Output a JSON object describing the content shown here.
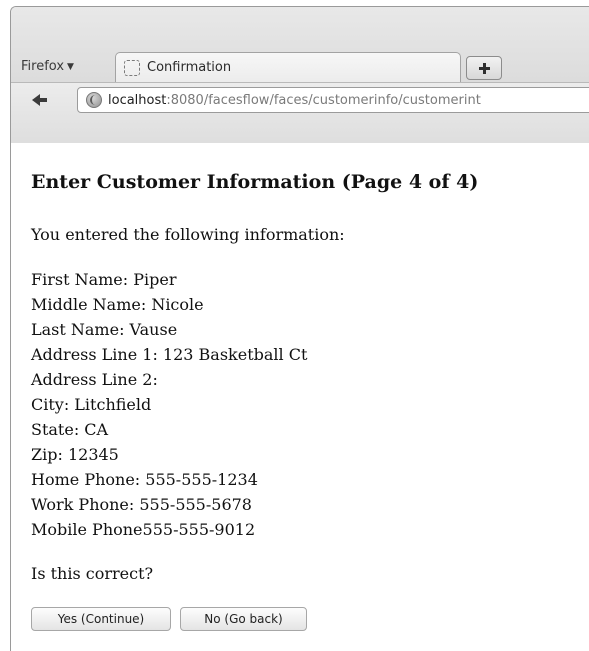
{
  "browser": {
    "menu_label": "Firefox",
    "menu_arrow": "▼",
    "tab_title": "Confirmation",
    "url_host": "localhost",
    "url_rest": ":8080/facesflow/faces/customerinfo/customerint",
    "icons": [
      "menu-arrow-icon",
      "page-favicon-icon",
      "new-tab-plus-icon",
      "back-arrow-icon",
      "globe-icon"
    ]
  },
  "page": {
    "title": "Enter Customer Information (Page 4 of 4)",
    "intro": "You entered the following information:",
    "fields": [
      "First Name: Piper",
      "Middle Name: Nicole",
      "Last Name: Vause",
      "Address Line 1: 123 Basketball Ct",
      "Address Line 2:",
      "City: Litchfield",
      "State: CA",
      "Zip: 12345",
      "Home Phone: 555-555-1234",
      "Work Phone: 555-555-5678",
      "Mobile Phone555-555-9012"
    ],
    "question": "Is this correct?",
    "yes_label": "Yes (Continue)",
    "no_label": "No (Go back)"
  }
}
